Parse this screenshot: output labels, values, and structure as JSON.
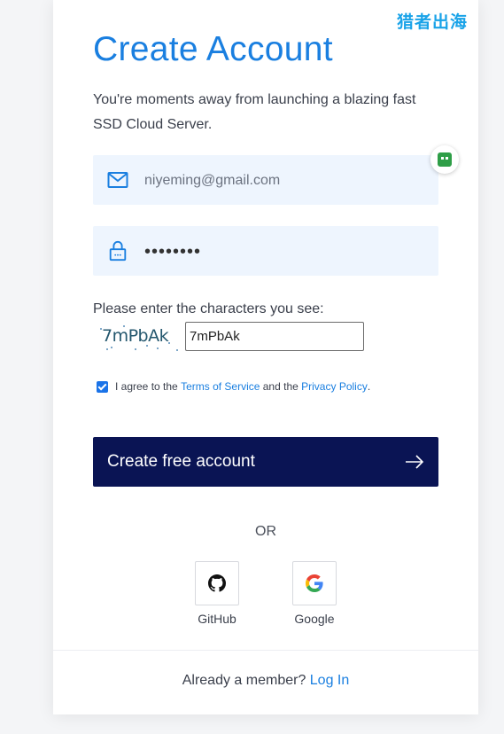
{
  "watermark": "猎者出海",
  "title": "Create Account",
  "subtitle": "You're moments away from launching a blazing fast SSD Cloud Server.",
  "email_field": {
    "value": "niyeming@gmail.com",
    "icon": "mail-icon"
  },
  "password_field": {
    "value": "••••••••",
    "icon": "lock-icon"
  },
  "captcha": {
    "label": "Please enter the characters you see:",
    "image_text": "7mPbAk",
    "input_value": "7mPbAk"
  },
  "agreement": {
    "checked": true,
    "prefix": "I agree to the ",
    "terms": "Terms of Service",
    "middle": " and the ",
    "privacy": "Privacy Policy",
    "suffix": "."
  },
  "cta": {
    "label": "Create free account",
    "icon": "arrow-right-icon"
  },
  "or_text": "OR",
  "social": [
    {
      "label": "GitHub",
      "icon": "github-icon"
    },
    {
      "label": "Google",
      "icon": "google-icon"
    }
  ],
  "footer": {
    "text": "Already a member? ",
    "link": "Log In"
  },
  "colors": {
    "accent": "#1a7fe0",
    "cta_bg": "#0a1454",
    "field_bg": "#eef5fe"
  }
}
